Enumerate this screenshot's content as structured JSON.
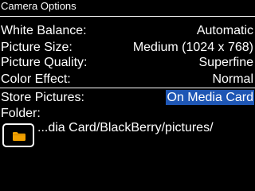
{
  "header": {
    "title": "Camera Options"
  },
  "options": {
    "white_balance": {
      "label": "White Balance:",
      "value": "Automatic"
    },
    "picture_size": {
      "label": "Picture Size:",
      "value": "Medium (1024 x 768)"
    },
    "picture_quality": {
      "label": "Picture Quality:",
      "value": "Superfine"
    },
    "color_effect": {
      "label": "Color Effect:",
      "value": "Normal"
    },
    "store_pictures": {
      "label": "Store Pictures:",
      "value": "On Media Card"
    },
    "folder": {
      "label": "Folder:",
      "path": "...dia Card/BlackBerry/pictures/"
    }
  },
  "icons": {
    "folder_button": "folder-icon"
  },
  "colors": {
    "background": "#000000",
    "text": "#ffffff",
    "selection": "#1e56b4",
    "folder_icon": "#f0a000"
  }
}
